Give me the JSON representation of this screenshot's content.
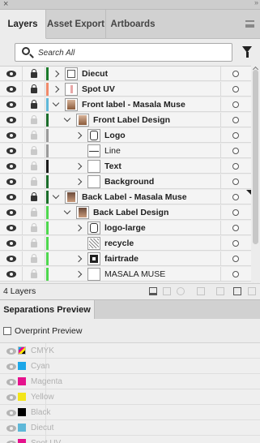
{
  "window": {
    "close_glyph": "×",
    "collapse_glyph": "»"
  },
  "tabs": [
    {
      "label": "Layers",
      "active": true
    },
    {
      "label": "Asset Export",
      "active": false
    },
    {
      "label": "Artboards",
      "active": false
    }
  ],
  "search": {
    "placeholder": "Search All",
    "value": ""
  },
  "layers": [
    {
      "name": "Diecut",
      "level": 0,
      "expander": "right",
      "visible": true,
      "locked": true,
      "color": "#1b7a2a",
      "thumb": "box",
      "bold": true
    },
    {
      "name": "Spot UV",
      "level": 0,
      "expander": "right",
      "visible": true,
      "locked": true,
      "color": "#f08a6a",
      "thumb": "spot",
      "bold": true
    },
    {
      "name": "Front label - Masala Muse",
      "level": 0,
      "expander": "down",
      "visible": true,
      "locked": true,
      "color": "#5fb8d8",
      "thumb": "art",
      "bold": true
    },
    {
      "name": "Front Label Design",
      "level": 1,
      "expander": "down",
      "visible": true,
      "locked": false,
      "color": "#1b6d2a",
      "thumb": "art",
      "bold": true
    },
    {
      "name": "Logo",
      "level": 2,
      "expander": "right",
      "visible": true,
      "locked": false,
      "color": "#9a9a9a",
      "thumb": "logo",
      "bold": true
    },
    {
      "name": "Line",
      "level": 2,
      "expander": "",
      "visible": true,
      "locked": false,
      "color": "#9a9a9a",
      "thumb": "line",
      "bold": false
    },
    {
      "name": "Text",
      "level": 2,
      "expander": "right",
      "visible": true,
      "locked": false,
      "color": "#1a1a1a",
      "thumb": "blank",
      "bold": true
    },
    {
      "name": "Background",
      "level": 2,
      "expander": "right",
      "visible": true,
      "locked": false,
      "color": "#1b6d2a",
      "thumb": "blank",
      "bold": true
    },
    {
      "name": "Back Label - Masala Muse",
      "level": 0,
      "expander": "down",
      "visible": true,
      "locked": true,
      "color": "#1b6d2a",
      "thumb": "art2",
      "bold": true
    },
    {
      "name": "Back Label Design",
      "level": 1,
      "expander": "down",
      "visible": true,
      "locked": false,
      "color": "#4fd84f",
      "thumb": "art2",
      "bold": true
    },
    {
      "name": "logo-large",
      "level": 2,
      "expander": "right",
      "visible": true,
      "locked": false,
      "color": "#4fd84f",
      "thumb": "logo",
      "bold": true
    },
    {
      "name": "recycle",
      "level": 2,
      "expander": "",
      "visible": true,
      "locked": false,
      "color": "#4fd84f",
      "thumb": "pattern",
      "bold": true
    },
    {
      "name": "fairtrade",
      "level": 2,
      "expander": "right",
      "visible": true,
      "locked": false,
      "color": "#4fd84f",
      "thumb": "ft",
      "bold": true
    },
    {
      "name": "MASALA MUSE",
      "level": 2,
      "expander": "right",
      "visible": true,
      "locked": false,
      "color": "#4fd84f",
      "thumb": "blank",
      "bold": false
    }
  ],
  "footer": {
    "layer_count": "4 Layers",
    "icons": [
      "collect-for-export-icon",
      "locate-object-icon",
      "make-clipping-mask-icon",
      "create-sublayer-icon",
      "new-layer-icon",
      "delete-layer-icon"
    ]
  },
  "separations": {
    "tab_label": "Separations Preview",
    "overprint_label": "Overprint Preview",
    "overprint_checked": false,
    "plates": [
      {
        "name": "CMYK",
        "swatch": "cmyk"
      },
      {
        "name": "Cyan",
        "swatch": "#1ca7e8"
      },
      {
        "name": "Magenta",
        "swatch": "#e5128d"
      },
      {
        "name": "Yellow",
        "swatch": "#f3e51a"
      },
      {
        "name": "Black",
        "swatch": "#000000"
      },
      {
        "name": "Diecut",
        "swatch": "#5fb8d8"
      },
      {
        "name": "Spot UV",
        "swatch": "#e5128d"
      }
    ]
  }
}
